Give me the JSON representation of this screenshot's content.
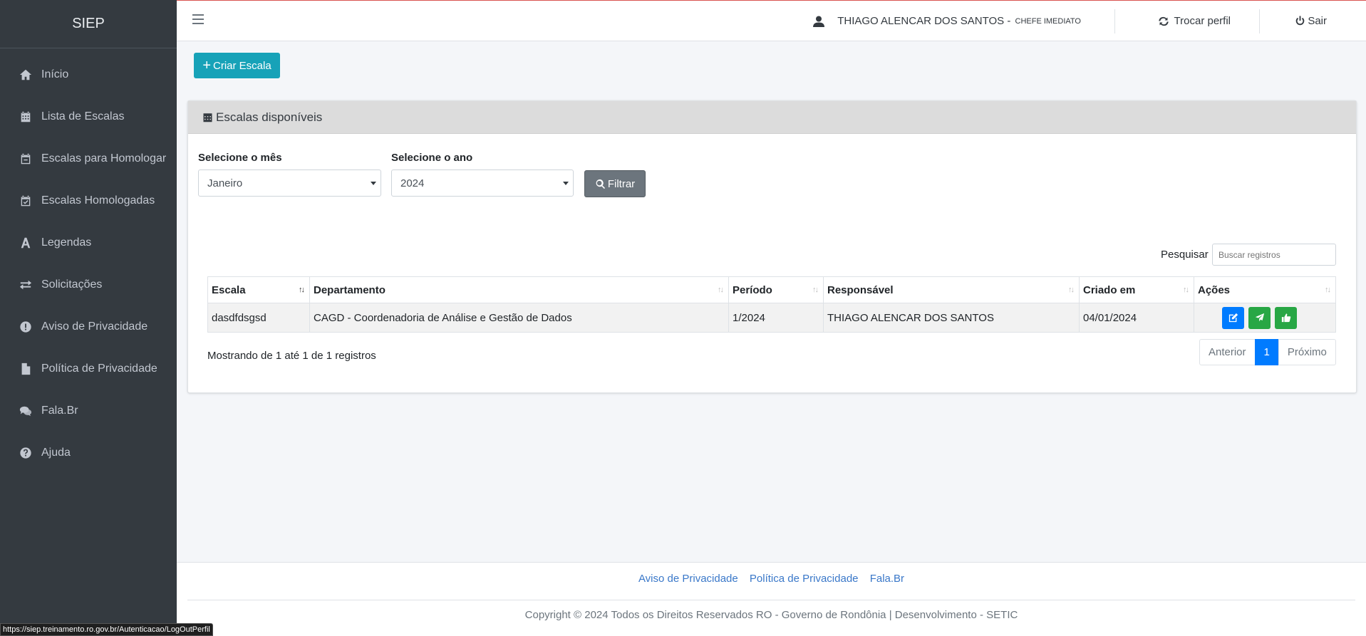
{
  "app": {
    "brand": "SIEP"
  },
  "sidebar": {
    "items": [
      {
        "label": "Início",
        "icon": "home-icon"
      },
      {
        "label": "Lista de Escalas",
        "icon": "calendar-icon"
      },
      {
        "label": "Escalas para Homologar",
        "icon": "calendar-minus-icon"
      },
      {
        "label": "Escalas Homologadas",
        "icon": "calendar-check-icon"
      },
      {
        "label": "Legendas",
        "icon": "font-icon"
      },
      {
        "label": "Solicitações",
        "icon": "exchange-icon"
      },
      {
        "label": "Aviso de Privacidade",
        "icon": "exclamation-circle-icon"
      },
      {
        "label": "Política de Privacidade",
        "icon": "file-icon"
      },
      {
        "label": "Fala.Br",
        "icon": "comments-icon"
      },
      {
        "label": "Ajuda",
        "icon": "question-circle-icon"
      }
    ]
  },
  "topbar": {
    "user_name": "THIAGO ALENCAR DOS SANTOS",
    "user_sep": "-",
    "user_role": "Chefe Imediato",
    "switch_profile": "Trocar perfil",
    "logout": "Sair"
  },
  "toolbar": {
    "create_label": "Criar Escala"
  },
  "card": {
    "title": "Escalas disponíveis",
    "month_label": "Selecione o mês",
    "month_value": "Janeiro",
    "year_label": "Selecione o ano",
    "year_value": "2024",
    "filter_label": "Filtrar",
    "search_label": "Pesquisar",
    "search_placeholder": "Buscar registros"
  },
  "table": {
    "columns": [
      "Escala",
      "Departamento",
      "Período",
      "Responsável",
      "Criado em",
      "Ações"
    ],
    "rows": [
      {
        "escala": "dasdfdsgsd",
        "departamento": "CAGD - Coordenadoria de Análise e Gestão de Dados",
        "periodo": "1/2024",
        "responsavel": "THIAGO ALENCAR DOS SANTOS",
        "criado_em": "04/01/2024"
      }
    ],
    "info": "Mostrando de 1 até 1 de 1 registros"
  },
  "pagination": {
    "prev": "Anterior",
    "current": "1",
    "next": "Próximo"
  },
  "footer": {
    "links": [
      "Aviso de Privacidade",
      "Política de Privacidade",
      "Fala.Br"
    ],
    "copyright": "Copyright © 2024 Todos os Direitos Reservados RO - Governo de Rondônia | Desenvolvimento - SETIC"
  },
  "status_bar": {
    "url": "https://siep.treinamento.ro.gov.br/Autenticacao/LogOutPerfil"
  },
  "colors": {
    "sidebar": "#343a40",
    "primary": "#007bff",
    "info": "#17a2b8",
    "success": "#28a745",
    "secondary": "#6c757d"
  }
}
